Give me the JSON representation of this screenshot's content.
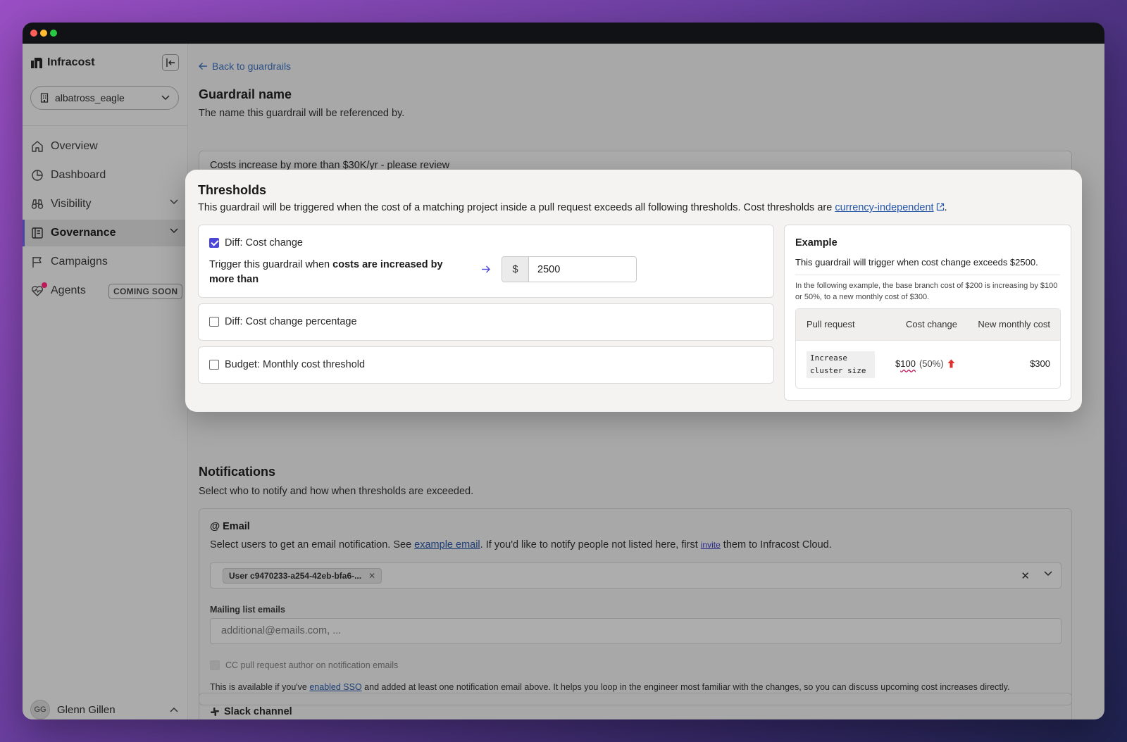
{
  "app": {
    "brand": "Infracost",
    "org": "albatross_eagle"
  },
  "sidebar": {
    "items": [
      {
        "label": "Overview"
      },
      {
        "label": "Dashboard"
      },
      {
        "label": "Visibility"
      },
      {
        "label": "Governance"
      },
      {
        "label": "Campaigns"
      },
      {
        "label": "Agents",
        "badge": "COMING SOON"
      }
    ],
    "user": {
      "initials": "GG",
      "name": "Glenn Gillen"
    }
  },
  "main": {
    "back_link": "Back to guardrails",
    "guardrail_name": {
      "title": "Guardrail name",
      "desc": "The name this guardrail will be referenced by.",
      "value": "Costs increase by more than $30K/yr - please review"
    },
    "notifications": {
      "title": "Notifications",
      "desc": "Select who to notify and how when thresholds are exceeded."
    },
    "email": {
      "icon_glyph": "@",
      "title": "Email",
      "desc_before": "Select users to get an email notification. See ",
      "example_link": "example email",
      "desc_middle": ". If you'd like to notify people not listed here, first ",
      "invite_link": "invite",
      "desc_after": " them to Infracost Cloud.",
      "selected_chip": "User c9470233-a254-42eb-bfa6-...",
      "clear_glyph": "✕",
      "chip_remove_glyph": "✕",
      "mailing_label": "Mailing list emails",
      "mailing_placeholder": "additional@emails.com, ...",
      "cc_label": "CC pull request author on notification emails",
      "sso_before": "This is available if you've ",
      "sso_link": "enabled SSO",
      "sso_after": " and added at least one notification email above. It helps you loop in the engineer most familiar with the changes, so you can discuss upcoming cost increases directly."
    },
    "slack": {
      "title": "Slack channel"
    }
  },
  "modal": {
    "title": "Thresholds",
    "desc": "This guardrail will be triggered when the cost of a matching project inside a pull request exceeds all following thresholds. Cost thresholds are ",
    "desc_link": "currency-independent",
    "desc_end": ".",
    "options": [
      {
        "label": "Diff: Cost change",
        "checked": true
      },
      {
        "label": "Diff: Cost change percentage",
        "checked": false
      },
      {
        "label": "Budget: Monthly cost threshold",
        "checked": false
      }
    ],
    "trigger_prefix": "Trigger this guardrail when ",
    "trigger_bold": "costs are increased by more than",
    "currency_symbol": "$",
    "threshold_value": "2500",
    "example": {
      "title": "Example",
      "summary": "This guardrail will trigger when cost change exceeds $2500.",
      "note": "In the following example, the base branch cost of $200 is increasing by $100 or 50%, to a new monthly cost of $300.",
      "columns": [
        "Pull request",
        "Cost change",
        "New monthly cost"
      ],
      "row": {
        "pr": "Increase cluster size",
        "change_prefix": "$",
        "change_amt": "100",
        "change_pct": "(50%)",
        "new_cost": "$300"
      }
    }
  },
  "colors": {
    "accent": "#4b46d6",
    "link": "#2557a7",
    "danger": "#e03131",
    "notif_dot": "#c0175c"
  }
}
